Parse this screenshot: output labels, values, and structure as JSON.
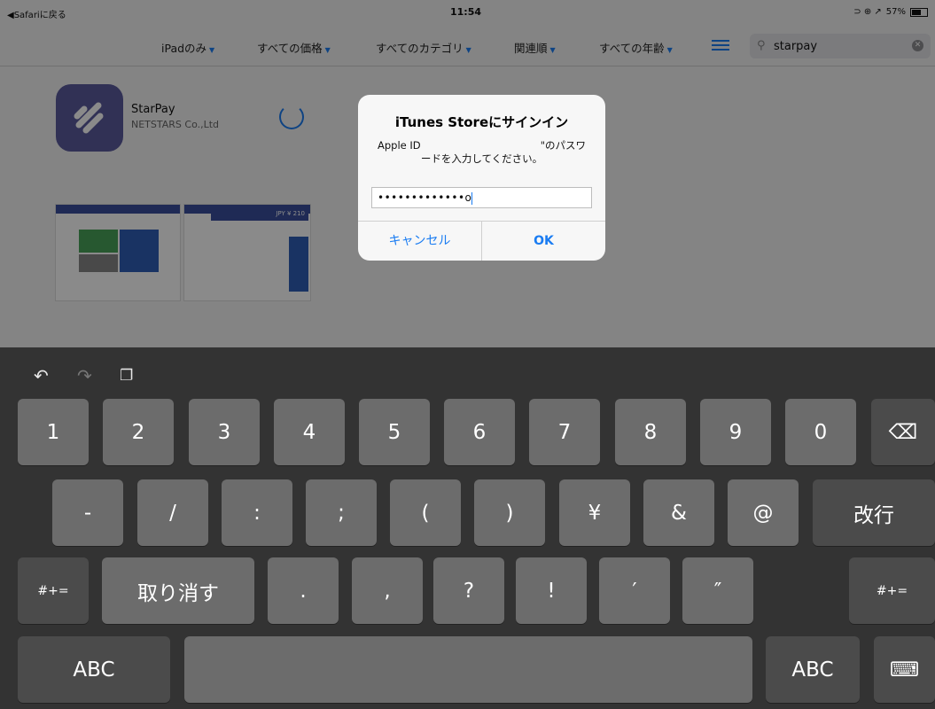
{
  "status_bar": {
    "back_label": "◀Safariに戻る",
    "time": "11:54",
    "battery": "57%",
    "indicators": "⊃ ⊕ ↗"
  },
  "filter_bar": {
    "items": [
      {
        "label": "iPadのみ"
      },
      {
        "label": "すべての価格"
      },
      {
        "label": "すべてのカテゴリ"
      },
      {
        "label": "関連順"
      },
      {
        "label": "すべての年齢"
      }
    ],
    "list_icon": "list-icon",
    "search_value": "starpay"
  },
  "app": {
    "name": "StarPay",
    "developer": "NETSTARS Co.,Ltd",
    "screenshot_label": "JPY ¥ 210"
  },
  "dialog": {
    "title": "iTunes Storeにサインイン",
    "message_prefix": "Apple ID",
    "message_suffix": "\"のパスワ",
    "message_line2": "ードを入力してください。",
    "password_value": "•••••••••••••o",
    "cancel_label": "キャンセル",
    "ok_label": "OK"
  },
  "keyboard": {
    "row1": [
      "1",
      "2",
      "3",
      "4",
      "5",
      "6",
      "7",
      "8",
      "9",
      "0"
    ],
    "backspace_icon": "⌫",
    "row2": [
      "-",
      "/",
      ":",
      ";",
      "(",
      ")",
      "¥",
      "&",
      "@"
    ],
    "return_label": "改行",
    "shift_label": "#+=",
    "undo_label": "取り消す",
    "row3": [
      ".",
      ",",
      "?",
      "!",
      "′",
      "″"
    ],
    "abc_label": "ABC",
    "dismiss_icon": "⌨"
  },
  "colors": {
    "accent": "#1a7cf2",
    "app_icon": "#5b5b9e",
    "keyboard_bg": "#333333",
    "key_bg": "#6c6c6c"
  }
}
